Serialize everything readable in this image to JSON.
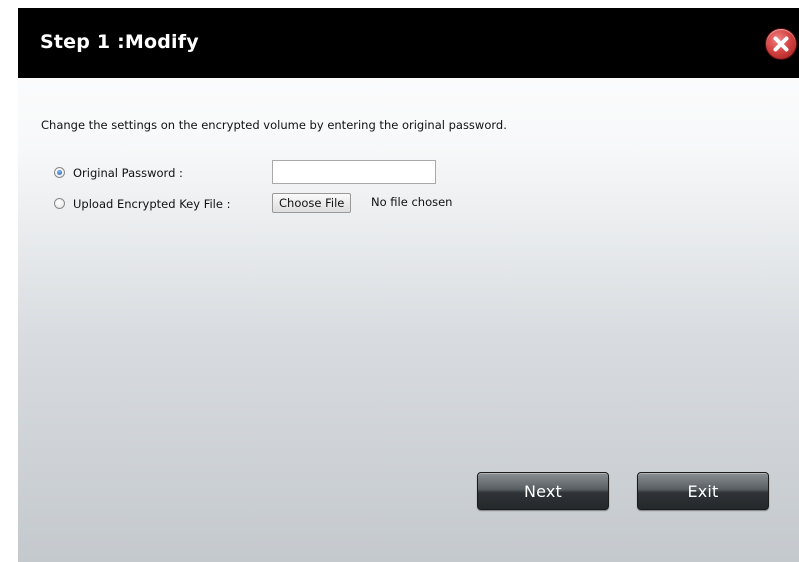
{
  "dialog": {
    "title": "Step 1 :Modify",
    "close_icon": "close-icon",
    "accent_color": "#d64545"
  },
  "content": {
    "instruction": "Change the settings on the encrypted volume by entering the original password.",
    "options": [
      {
        "label": "Original Password :",
        "selected": true
      },
      {
        "label": "Upload Encrypted Key File :",
        "selected": false
      }
    ],
    "password_value": "",
    "choose_file_label": "Choose File",
    "no_file_text": "No file chosen"
  },
  "buttons": {
    "next_label": "Next",
    "exit_label": "Exit"
  }
}
